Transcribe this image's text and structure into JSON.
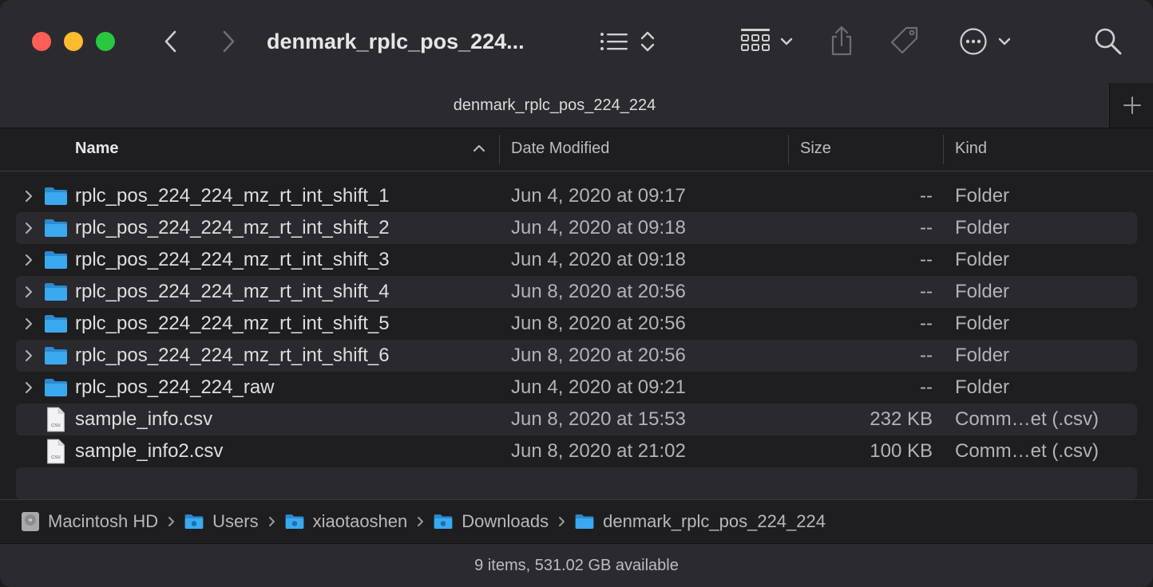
{
  "window": {
    "title": "denmark_rplc_pos_224...",
    "tab_title": "denmark_rplc_pos_224_224"
  },
  "toolbar": {
    "icons": [
      "back-icon",
      "forward-icon",
      "list-view-icon",
      "sort-arrows-icon",
      "grid-view-icon",
      "chevron-down-icon",
      "share-icon",
      "tag-icon",
      "more-icon",
      "search-icon"
    ]
  },
  "columns": {
    "name": "Name",
    "date": "Date Modified",
    "size": "Size",
    "kind": "Kind"
  },
  "files": [
    {
      "name": "rplc_pos_224_224_mz_rt_int_shift_1",
      "date": "Jun 4, 2020 at 09:17",
      "size": "--",
      "kind": "Folder",
      "type": "folder"
    },
    {
      "name": "rplc_pos_224_224_mz_rt_int_shift_2",
      "date": "Jun 4, 2020 at 09:18",
      "size": "--",
      "kind": "Folder",
      "type": "folder"
    },
    {
      "name": "rplc_pos_224_224_mz_rt_int_shift_3",
      "date": "Jun 4, 2020 at 09:18",
      "size": "--",
      "kind": "Folder",
      "type": "folder"
    },
    {
      "name": "rplc_pos_224_224_mz_rt_int_shift_4",
      "date": "Jun 8, 2020 at 20:56",
      "size": "--",
      "kind": "Folder",
      "type": "folder"
    },
    {
      "name": "rplc_pos_224_224_mz_rt_int_shift_5",
      "date": "Jun 8, 2020 at 20:56",
      "size": "--",
      "kind": "Folder",
      "type": "folder"
    },
    {
      "name": "rplc_pos_224_224_mz_rt_int_shift_6",
      "date": "Jun 8, 2020 at 20:56",
      "size": "--",
      "kind": "Folder",
      "type": "folder"
    },
    {
      "name": "rplc_pos_224_224_raw",
      "date": "Jun 4, 2020 at 09:21",
      "size": "--",
      "kind": "Folder",
      "type": "folder"
    },
    {
      "name": "sample_info.csv",
      "date": "Jun 8, 2020 at 15:53",
      "size": "232 KB",
      "kind": "Comm…et (.csv)",
      "type": "csv"
    },
    {
      "name": "sample_info2.csv",
      "date": "Jun 8, 2020 at 21:02",
      "size": "100 KB",
      "kind": "Comm…et (.csv)",
      "type": "csv"
    }
  ],
  "csv_icon_label": "CSV",
  "path": [
    {
      "label": "Macintosh HD",
      "icon": "hard-drive-icon"
    },
    {
      "label": "Users",
      "icon": "users-folder-icon"
    },
    {
      "label": "xiaotaoshen",
      "icon": "home-folder-icon"
    },
    {
      "label": "Downloads",
      "icon": "downloads-folder-icon"
    },
    {
      "label": "denmark_rplc_pos_224_224",
      "icon": "folder-icon"
    }
  ],
  "status": "9 items, 531.02 GB available",
  "colors": {
    "folder": "#3aa9f0",
    "close": "#ff5f57",
    "minimize": "#febc2e",
    "zoom": "#28c840"
  }
}
